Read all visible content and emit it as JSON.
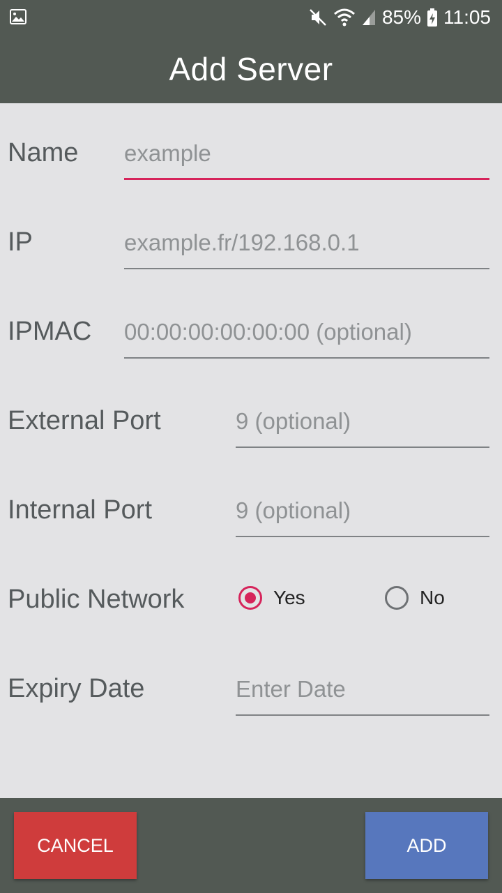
{
  "status_bar": {
    "battery": "85%",
    "time": "11:05",
    "icons": [
      "gallery-icon",
      "mute-icon",
      "wifi-icon",
      "signal-icon",
      "battery-charging-icon"
    ]
  },
  "app_bar": {
    "title": "Add Server"
  },
  "form": {
    "name": {
      "label": "Name",
      "value": "",
      "placeholder": "example"
    },
    "ip": {
      "label": "IP",
      "value": "",
      "placeholder": "example.fr/192.168.0.1"
    },
    "ipmac": {
      "label": "IPMAC",
      "value": "",
      "placeholder": "00:00:00:00:00:00 (optional)"
    },
    "external_port": {
      "label": "External Port",
      "value": "",
      "placeholder": "9 (optional)"
    },
    "internal_port": {
      "label": "Internal Port",
      "value": "",
      "placeholder": "9 (optional)"
    },
    "public_network": {
      "label": "Public Network",
      "options": [
        "Yes",
        "No"
      ],
      "selected": "Yes"
    },
    "expiry_date": {
      "label": "Expiry Date",
      "value": "",
      "placeholder": "Enter Date"
    }
  },
  "buttons": {
    "cancel": "CANCEL",
    "add": "ADD"
  },
  "colors": {
    "bars": "#525953",
    "background": "#e3e3e5",
    "accent": "#d6245b",
    "cancel": "#cf3c3c",
    "add": "#5777bd"
  }
}
